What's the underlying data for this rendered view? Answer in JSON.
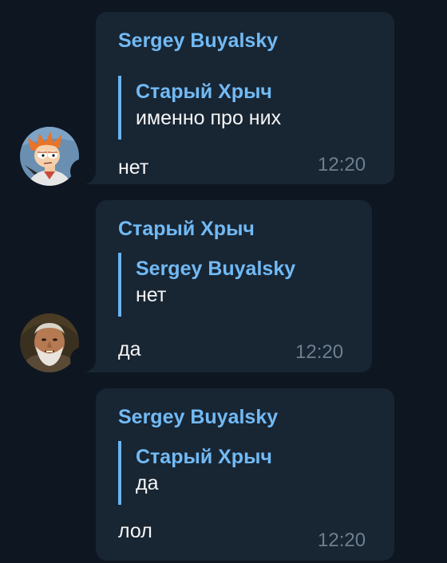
{
  "messages": [
    {
      "sender": "Sergey Buyalsky",
      "reply": {
        "name": "Старый Хрыч",
        "text": "именно про них"
      },
      "text": "нет",
      "time": "12:20",
      "avatar_icon": "fry-cartoon-avatar"
    },
    {
      "sender": "Старый Хрыч",
      "reply": {
        "name": "Sergey Buyalsky",
        "text": "нет"
      },
      "text": "да",
      "time": "12:20",
      "avatar_icon": "old-man-photo-avatar"
    },
    {
      "sender": "Sergey Buyalsky",
      "reply": {
        "name": "Старый Хрыч",
        "text": "да"
      },
      "text": "лол",
      "time": "12:20"
    }
  ],
  "colors": {
    "background": "#0e1621",
    "bubble": "#182533",
    "name_accent": "#71baf5",
    "reply_bar": "#6ab3f3",
    "text": "#f5f5f5",
    "time": "#6d7f8f"
  }
}
